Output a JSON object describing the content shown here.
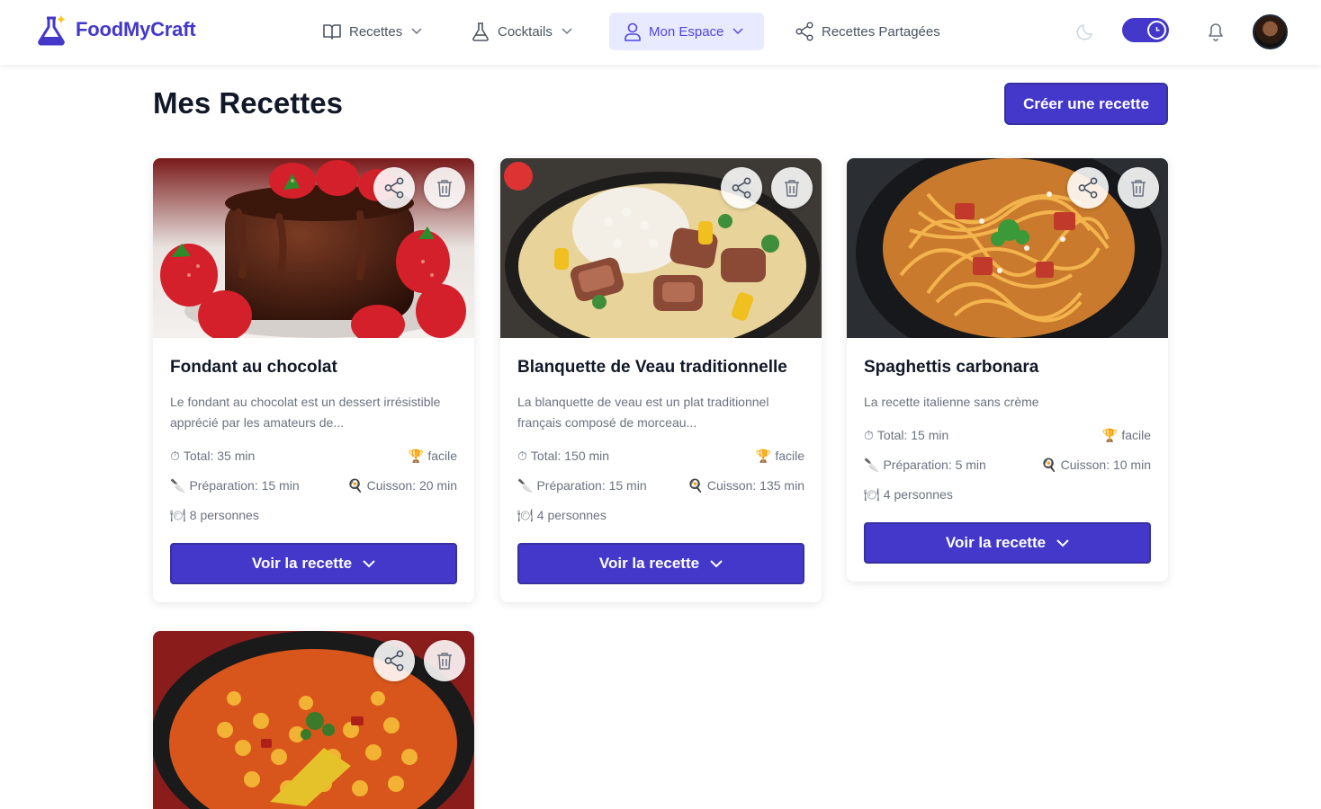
{
  "app": {
    "brand": "FoodMyCraft",
    "accent_color": "#4338ca"
  },
  "nav": {
    "items": [
      {
        "label": "Recettes",
        "icon": "book-icon",
        "has_dropdown": true,
        "active": false
      },
      {
        "label": "Cocktails",
        "icon": "flask-icon",
        "has_dropdown": true,
        "active": false
      },
      {
        "label": "Mon Espace",
        "icon": "user-icon",
        "has_dropdown": true,
        "active": true
      },
      {
        "label": "Recettes Partagées",
        "icon": "share-icon",
        "has_dropdown": false,
        "active": false
      }
    ],
    "right_icons": [
      "moon-icon",
      "theme-toggle",
      "bell-icon",
      "avatar"
    ]
  },
  "page": {
    "title": "Mes Recettes",
    "create_button": "Créer une recette"
  },
  "recipes": [
    {
      "title": "Fondant au chocolat",
      "description": "Le fondant au chocolat est un dessert irrésistible apprécié par les amateurs de...",
      "total": "Total: 35 min",
      "difficulty": "facile",
      "prep": "Préparation: 15 min",
      "cook": "Cuisson: 20 min",
      "servings": "8 personnes",
      "button": "Voir la recette"
    },
    {
      "title": "Blanquette de Veau traditionnelle",
      "description": "La blanquette de veau est un plat traditionnel français composé de morceau...",
      "total": "Total: 150 min",
      "difficulty": "facile",
      "prep": "Préparation: 15 min",
      "cook": "Cuisson: 135 min",
      "servings": "4 personnes",
      "button": "Voir la recette"
    },
    {
      "title": "Spaghettis carbonara",
      "description": "La recette italienne sans crème",
      "total": "Total: 15 min",
      "difficulty": "facile",
      "prep": "Préparation: 5 min",
      "cook": "Cuisson: 10 min",
      "servings": "4 personnes",
      "button": "Voir la recette"
    }
  ]
}
